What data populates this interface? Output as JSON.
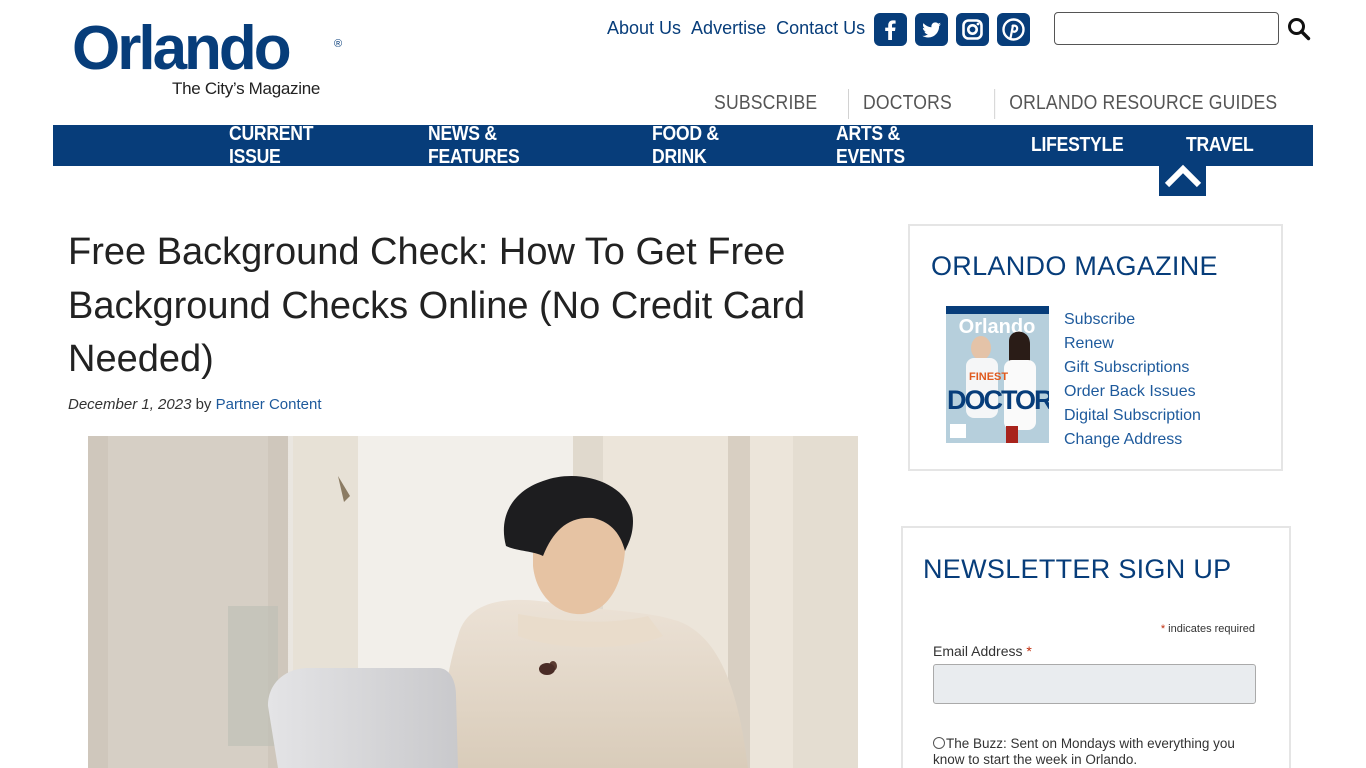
{
  "logo": {
    "word": "Orlando",
    "reg": "®",
    "tagline": "The City’s Magazine"
  },
  "top_links": [
    "About Us",
    "Advertise",
    "Contact Us"
  ],
  "social": [
    "facebook-icon",
    "twitter-icon",
    "instagram-icon",
    "pinterest-icon"
  ],
  "search": {
    "value": "",
    "placeholder": ""
  },
  "sub_links": [
    "SUBSCRIBE",
    "DOCTORS",
    "ORLANDO RESOURCE GUIDES"
  ],
  "nav": [
    "CURRENT ISSUE",
    "NEWS & FEATURES",
    "FOOD & DRINK",
    "ARTS & EVENTS",
    "LIFESTYLE",
    "TRAVEL"
  ],
  "article": {
    "title": "Free Background Check: How To Get Free Background Checks Online (No Credit Card Needed)",
    "date": "December 1, 2023",
    "by": "by",
    "author": "Partner Content"
  },
  "magazine_widget": {
    "title": "ORLANDO MAGAZINE",
    "cover": {
      "brand": "Orlando",
      "headline_1": "FINEST",
      "headline_2": "DOCTORS"
    },
    "links": [
      "Subscribe",
      "Renew",
      "Gift Subscriptions",
      "Order Back Issues",
      "Digital Subscription",
      "Change Address"
    ]
  },
  "newsletter_widget": {
    "title": "NEWSLETTER SIGN UP",
    "required_star": "*",
    "required_note": "indicates required",
    "email_label": "Email Address",
    "email_value": "",
    "buzz_label": "The Buzz: Sent on Mondays with everything you know to start the week in Orlando."
  },
  "colors": {
    "brand_blue": "#073d7a",
    "link_blue": "#1e5a9c",
    "required_red": "#c02b0a"
  }
}
